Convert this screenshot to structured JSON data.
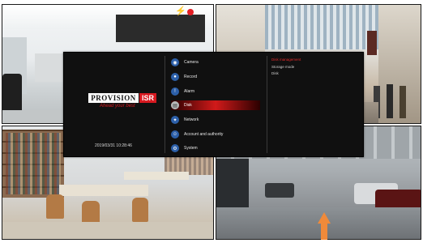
{
  "menu": {
    "logo": {
      "brand": "PROVISION",
      "suffix": "ISR",
      "slogan": "Ahead your best"
    },
    "datetime": "2019/03/31 10:28:46",
    "items": [
      {
        "label": "Camera",
        "icon": "camera-icon"
      },
      {
        "label": "Record",
        "icon": "record-icon"
      },
      {
        "label": "Alarm",
        "icon": "alarm-icon"
      },
      {
        "label": "Disk",
        "icon": "disk-icon",
        "selected": true
      },
      {
        "label": "Network",
        "icon": "network-icon"
      },
      {
        "label": "Account and authority",
        "icon": "account-icon"
      },
      {
        "label": "System",
        "icon": "system-icon"
      }
    ],
    "submenu": [
      {
        "label": "Disk management",
        "selected": true
      },
      {
        "label": "Storage mode"
      },
      {
        "label": "Disk"
      }
    ]
  },
  "status": {
    "alert_icon": "lightning-icon",
    "record_dot": "#e31e24"
  }
}
